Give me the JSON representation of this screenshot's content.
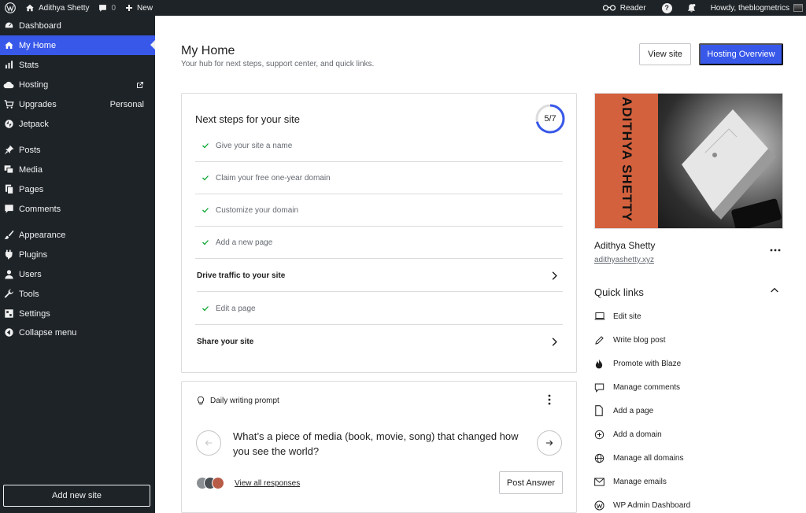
{
  "adminbar": {
    "site_name": "Adithya Shetty",
    "comments_count": "0",
    "new_label": "New",
    "reader_label": "Reader",
    "help_label": "?",
    "howdy": "Howdy, theblogmetrics"
  },
  "sidebar": {
    "items": [
      {
        "label": "Dashboard",
        "icon": "dashboard-icon"
      },
      {
        "label": "My Home",
        "icon": "home-icon",
        "active": true
      },
      {
        "label": "Stats",
        "icon": "stats-icon"
      },
      {
        "label": "Hosting",
        "icon": "hosting-icon",
        "external": true
      },
      {
        "label": "Upgrades",
        "icon": "cart-icon",
        "extra": "Personal"
      },
      {
        "label": "Jetpack",
        "icon": "jetpack-icon"
      },
      {
        "label": "Posts",
        "icon": "pin-icon"
      },
      {
        "label": "Media",
        "icon": "media-icon"
      },
      {
        "label": "Pages",
        "icon": "pages-icon"
      },
      {
        "label": "Comments",
        "icon": "comment-icon"
      },
      {
        "label": "Appearance",
        "icon": "brush-icon"
      },
      {
        "label": "Plugins",
        "icon": "plugin-icon"
      },
      {
        "label": "Users",
        "icon": "users-icon"
      },
      {
        "label": "Tools",
        "icon": "wrench-icon"
      },
      {
        "label": "Settings",
        "icon": "settings-icon"
      },
      {
        "label": "Collapse menu",
        "icon": "collapse-icon"
      }
    ],
    "add_site_label": "Add new site"
  },
  "header": {
    "title": "My Home",
    "subtitle": "Your hub for next steps, support center, and quick links.",
    "view_site_label": "View site",
    "hosting_overview_label": "Hosting Overview"
  },
  "next_steps": {
    "title": "Next steps for your site",
    "progress_label": "5/7",
    "progress_fraction": 0.714,
    "tasks": [
      {
        "label": "Give your site a name",
        "done": true
      },
      {
        "label": "Claim your free one-year domain",
        "done": true
      },
      {
        "label": "Customize your domain",
        "done": true
      },
      {
        "label": "Add a new page",
        "done": true
      },
      {
        "label": "Drive traffic to your site",
        "done": false
      },
      {
        "label": "Edit a page",
        "done": true
      },
      {
        "label": "Share your site",
        "done": false
      }
    ]
  },
  "prompt": {
    "header": "Daily writing prompt",
    "text": "What’s a piece of media (book, movie, song) that changed how you see the world?",
    "view_responses": "View all responses",
    "post_answer": "Post Answer"
  },
  "site": {
    "thumb_brand": "ADITHYA SHETTY",
    "name": "Adithya Shetty",
    "url": "adithyashetty.xyz"
  },
  "quick_links": {
    "title": "Quick links",
    "items": [
      {
        "label": "Edit site",
        "icon": "laptop-icon"
      },
      {
        "label": "Write blog post",
        "icon": "pencil-icon"
      },
      {
        "label": "Promote with Blaze",
        "icon": "flame-icon"
      },
      {
        "label": "Manage comments",
        "icon": "comment-outline-icon"
      },
      {
        "label": "Add a page",
        "icon": "page-icon"
      },
      {
        "label": "Add a domain",
        "icon": "plus-circle-icon"
      },
      {
        "label": "Manage all domains",
        "icon": "globe-icon"
      },
      {
        "label": "Manage emails",
        "icon": "mail-icon"
      },
      {
        "label": "WP Admin Dashboard",
        "icon": "wordpress-icon"
      }
    ]
  },
  "colors": {
    "accent": "#3858e9",
    "sidebar_bg": "#1d2327",
    "check": "#00a32a",
    "thumb_band": "#d4613e"
  }
}
